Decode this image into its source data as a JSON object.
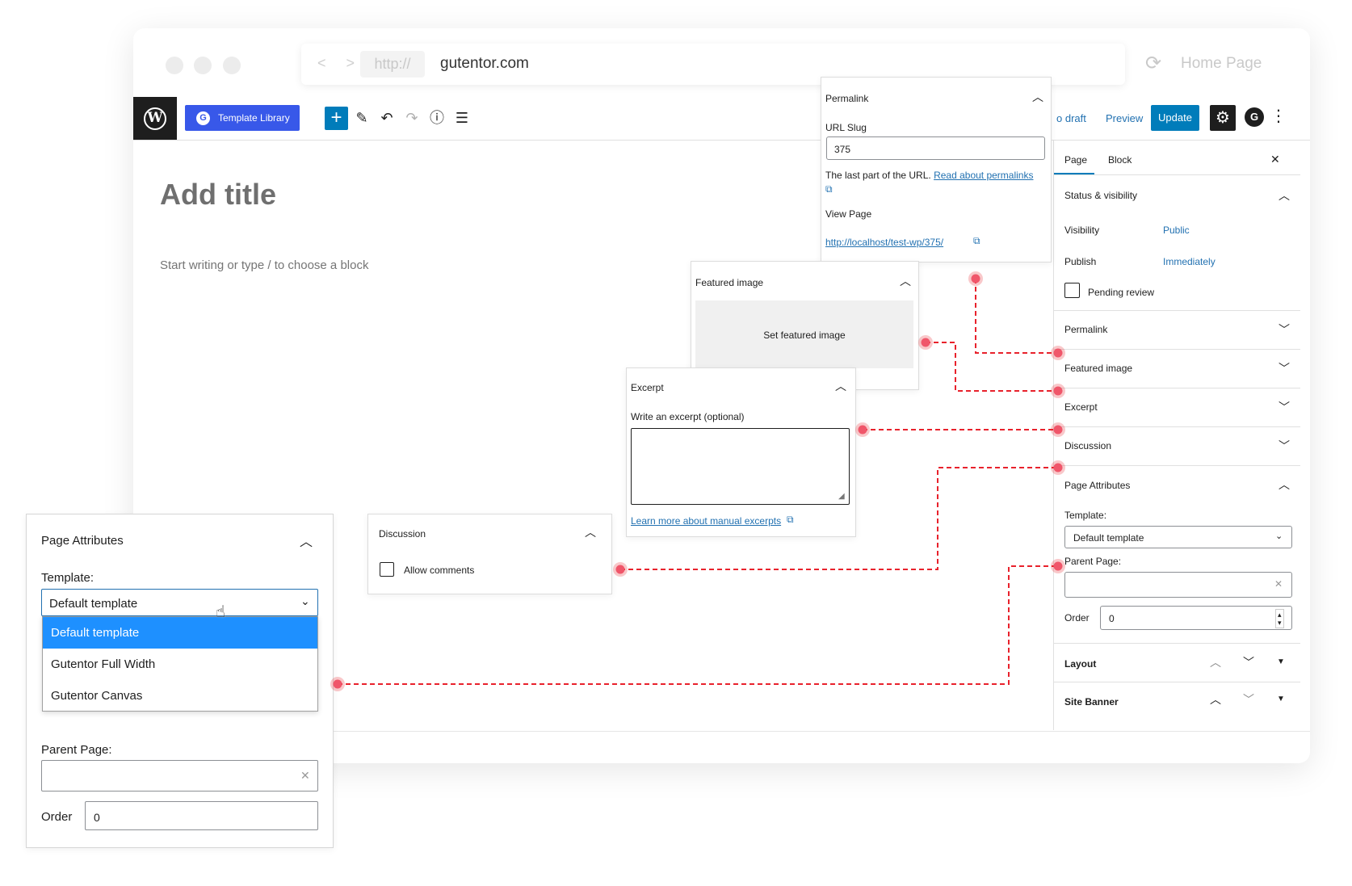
{
  "browser": {
    "protocol": "http://",
    "domain": "gutentor.com",
    "nav_glyph": "< >",
    "reload_glyph": "⟳",
    "home_label": "Home Page"
  },
  "toolbar": {
    "wp_logo_glyph": "W",
    "template_library_label": "Template Library",
    "template_library_icon_glyph": "G",
    "add_block_glyph": "+",
    "edit_glyph": "✎",
    "undo_glyph": "↶",
    "redo_glyph": "↷",
    "info_glyph": "ⓘ",
    "list_view_glyph": "☰",
    "save_draft_label": "o draft",
    "preview_label": "Preview",
    "update_label": "Update",
    "settings_glyph": "⚙",
    "plugin_glyph": "G",
    "more_glyph": "⋮"
  },
  "editor": {
    "title_placeholder": "Add title",
    "block_placeholder": "Start writing or type / to choose a block"
  },
  "sidebar": {
    "tabs": [
      "Page",
      "Block"
    ],
    "close_glyph": "✕",
    "status_visibility": {
      "title": "Status & visibility",
      "visibility_label": "Visibility",
      "visibility_value": "Public",
      "publish_label": "Publish",
      "publish_value": "Immediately",
      "pending_review_label": "Pending review"
    },
    "sections": [
      "Permalink",
      "Featured image",
      "Excerpt",
      "Discussion"
    ],
    "page_attributes": {
      "title": "Page Attributes",
      "template_label": "Template:",
      "template_value": "Default template",
      "parent_label": "Parent Page:",
      "order_label": "Order",
      "order_value": "0"
    },
    "layout_label": "Layout",
    "site_banner_label": "Site Banner"
  },
  "permalink_panel": {
    "title": "Permalink",
    "url_slug_label": "URL Slug",
    "url_slug_value": "375",
    "help_text": "The last part of the URL.",
    "help_link": "Read about permalinks",
    "view_page_label": "View Page",
    "view_page_url": "http://localhost/test-wp/375/"
  },
  "featured_image_panel": {
    "title": "Featured image",
    "button_label": "Set featured image"
  },
  "excerpt_panel": {
    "title": "Excerpt",
    "field_label": "Write an excerpt (optional)",
    "learn_more": "Learn more about manual excerpts"
  },
  "discussion_panel": {
    "title": "Discussion",
    "allow_comments_label": "Allow comments"
  },
  "page_attributes_panel": {
    "title": "Page Attributes",
    "template_label": "Template:",
    "selected_template": "Default template",
    "options": [
      "Default template",
      "Gutentor Full Width",
      "Gutentor Canvas"
    ],
    "parent_label": "Parent Page:",
    "order_label": "Order",
    "order_value": "0"
  },
  "colors": {
    "wp_blue": "#007cba",
    "link_blue": "#2271b1",
    "template_library_blue": "#3858e9",
    "dropdown_highlight": "#1e90ff",
    "connector_red": "#e8222c"
  }
}
